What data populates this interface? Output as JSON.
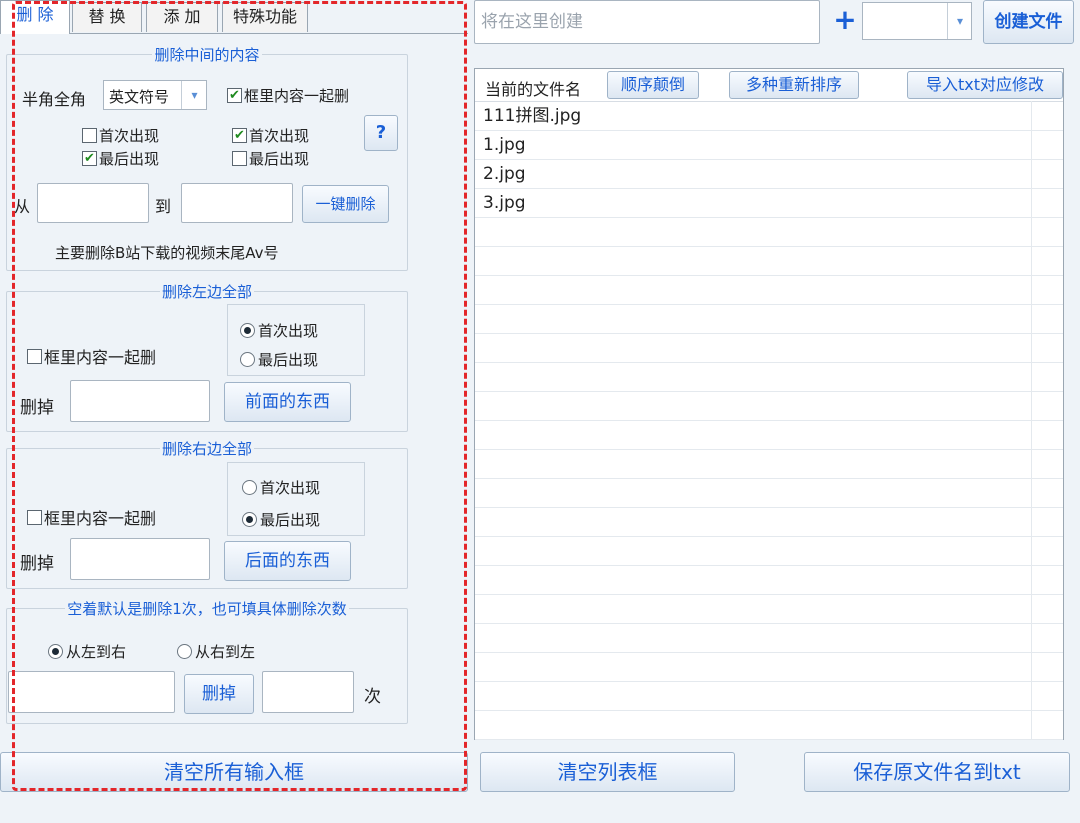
{
  "tabs": [
    {
      "label": "删 除"
    },
    {
      "label": "替 换"
    },
    {
      "label": "添 加"
    },
    {
      "label": "特殊功能"
    }
  ],
  "middle_group": {
    "title": "删除中间的内容",
    "width_label": "半角全角",
    "symbol_select_value": "英文符号",
    "include_box_label": "框里内容一起删",
    "include_box_checked": true,
    "left_first_label": "首次出现",
    "left_first_checked": false,
    "left_last_label": "最后出现",
    "left_last_checked": true,
    "right_first_label": "首次出现",
    "right_first_checked": true,
    "right_last_label": "最后出现",
    "right_last_checked": false,
    "help_label": "?",
    "from_label": "从",
    "to_label": "到",
    "delete_button": "一键删除",
    "note": "主要删除B站下载的视频末尾Av号"
  },
  "left_group": {
    "title": "删除左边全部",
    "include_box_label": "框里内容一起删",
    "first_label": "首次出现",
    "first_selected": true,
    "last_label": "最后出现",
    "last_selected": false,
    "delete_label": "删掉",
    "button": "前面的东西"
  },
  "right_group": {
    "title": "删除右边全部",
    "include_box_label": "框里内容一起删",
    "first_label": "首次出现",
    "first_selected": false,
    "last_label": "最后出现",
    "last_selected": true,
    "delete_label": "删掉",
    "button": "后面的东西"
  },
  "count_group": {
    "title": "空着默认是删除1次，也可填具体删除次数",
    "ltr_label": "从左到右",
    "ltr_selected": true,
    "rtl_label": "从右到左",
    "rtl_selected": false,
    "delete_button": "删掉",
    "times_label": "次"
  },
  "clear_inputs_button": "清空所有输入框",
  "top_bar": {
    "create_placeholder": "将在这里创建",
    "plus": "+",
    "create_button": "创建文件"
  },
  "list": {
    "header_label": "当前的文件名",
    "reverse_button": "顺序颠倒",
    "resort_button": "多种重新排序",
    "import_button": "导入txt对应修改",
    "rows": [
      "111拼图.jpg",
      "1.jpg",
      "2.jpg",
      "3.jpg",
      "",
      "",
      "",
      "",
      "",
      "",
      "",
      "",
      "",
      "",
      "",
      "",
      "",
      "",
      "",
      "",
      "",
      ""
    ]
  },
  "clear_list_button": "清空列表框",
  "save_button": "保存原文件名到txt",
  "colors": {
    "accent": "#1a5fd6",
    "highlight": "#e3262a",
    "check": "#1f8a1f"
  },
  "icons": {
    "chevron": "chevron-down-icon",
    "plus": "plus-icon",
    "check": "check-icon"
  }
}
